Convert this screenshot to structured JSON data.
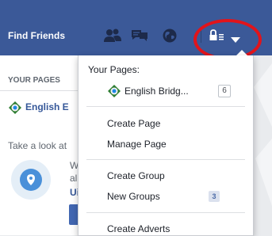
{
  "colors": {
    "brand": "#3b5998",
    "highlight_ring": "#e1141b"
  },
  "topbar": {
    "find_friends": "Find Friends",
    "icons": [
      "friend-requests-icon",
      "messages-icon",
      "notifications-globe-icon",
      "privacy-lock-icon",
      "account-dropdown-arrow-icon"
    ]
  },
  "left": {
    "your_pages": "YOUR PAGES",
    "page_name": "English E",
    "take_look": "Take a look at",
    "frag_w": "W",
    "frag_al": "al",
    "frag_ui": "Ui"
  },
  "menu": {
    "heading": "Your Pages:",
    "page_name": "English Bridg...",
    "page_count": "6",
    "items": {
      "create_page": "Create Page",
      "manage_page": "Manage Page",
      "create_group": "Create Group",
      "new_groups": "New Groups",
      "new_groups_badge": "3",
      "create_adverts": "Create Adverts"
    }
  }
}
